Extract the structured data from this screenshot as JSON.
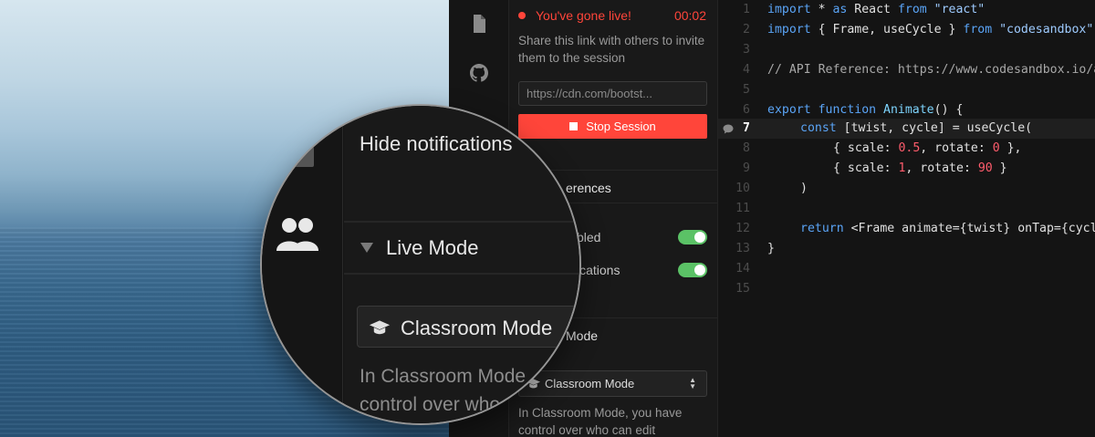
{
  "session": {
    "live_label": "You've gone live!",
    "timer": "00:02",
    "share_text": "Share this link with others to invite them to the session",
    "link_value": "https://cdn.com/bootst...",
    "stop_label": "Stop Session"
  },
  "preferences": {
    "title_visible": "erences",
    "enabled_label": "bled",
    "notifications_label": "ications"
  },
  "mode": {
    "title_visible": "Mode",
    "select_value": "Classroom Mode",
    "description": "In Classroom Mode, you have control over who can edit"
  },
  "magnified": {
    "hide_notifications": "Hide notifications",
    "live_mode": "Live Mode",
    "classroom_button": "Classroom Mode",
    "desc_line1": "In Classroom Mode",
    "desc_line2": "control over who"
  },
  "editor": {
    "active_line": 7,
    "lines": [
      {
        "n": "1"
      },
      {
        "n": "2"
      },
      {
        "n": "3"
      },
      {
        "n": "4"
      },
      {
        "n": "5"
      },
      {
        "n": "6"
      },
      {
        "n": "7"
      },
      {
        "n": "8"
      },
      {
        "n": "9"
      },
      {
        "n": "10"
      },
      {
        "n": "11"
      },
      {
        "n": "12"
      },
      {
        "n": "13"
      },
      {
        "n": "14"
      },
      {
        "n": "15"
      }
    ],
    "code": {
      "l1_kw1": "import",
      "l1_t1": " * ",
      "l1_kw2": "as",
      "l1_t2": " React ",
      "l1_kw3": "from",
      "l1_str": " \"react\"",
      "l2_kw1": "import",
      "l2_t1": " { Frame, useCycle } ",
      "l2_kw2": "from",
      "l2_str": " \"codesandbox\"",
      "l4_cm": "// API Reference: https://www.codesandbox.io/api",
      "l6_kw1": "export",
      "l6_kw2": " function",
      "l6_fn": " Animate",
      "l6_t": "() {",
      "l7_kw": "const",
      "l7_t": " [twist, cycle] = useCycle(",
      "l8_t1": "{ scale: ",
      "l8_n1": "0.5",
      "l8_t2": ", rotate: ",
      "l8_n2": "0",
      "l8_t3": " },",
      "l9_t1": "{ scale: ",
      "l9_n1": "1",
      "l9_t2": ", rotate: ",
      "l9_n2": "90",
      "l9_t3": " }",
      "l10_t": ")",
      "l12_kw": "return",
      "l12_t": " <Frame animate={twist} onTap={cycle} />",
      "l13_t": "}"
    }
  },
  "colors": {
    "accent_red": "#ff453a",
    "toggle_green": "#5bc266",
    "keyword_blue": "#5aa4f6",
    "number_red": "#ff5c6c"
  },
  "icons": [
    "file-icon",
    "github-icon",
    "live-users-icon",
    "graduation-cap-icon",
    "comment-icon",
    "select-arrows-icon",
    "collapse-triangle-icon"
  ]
}
